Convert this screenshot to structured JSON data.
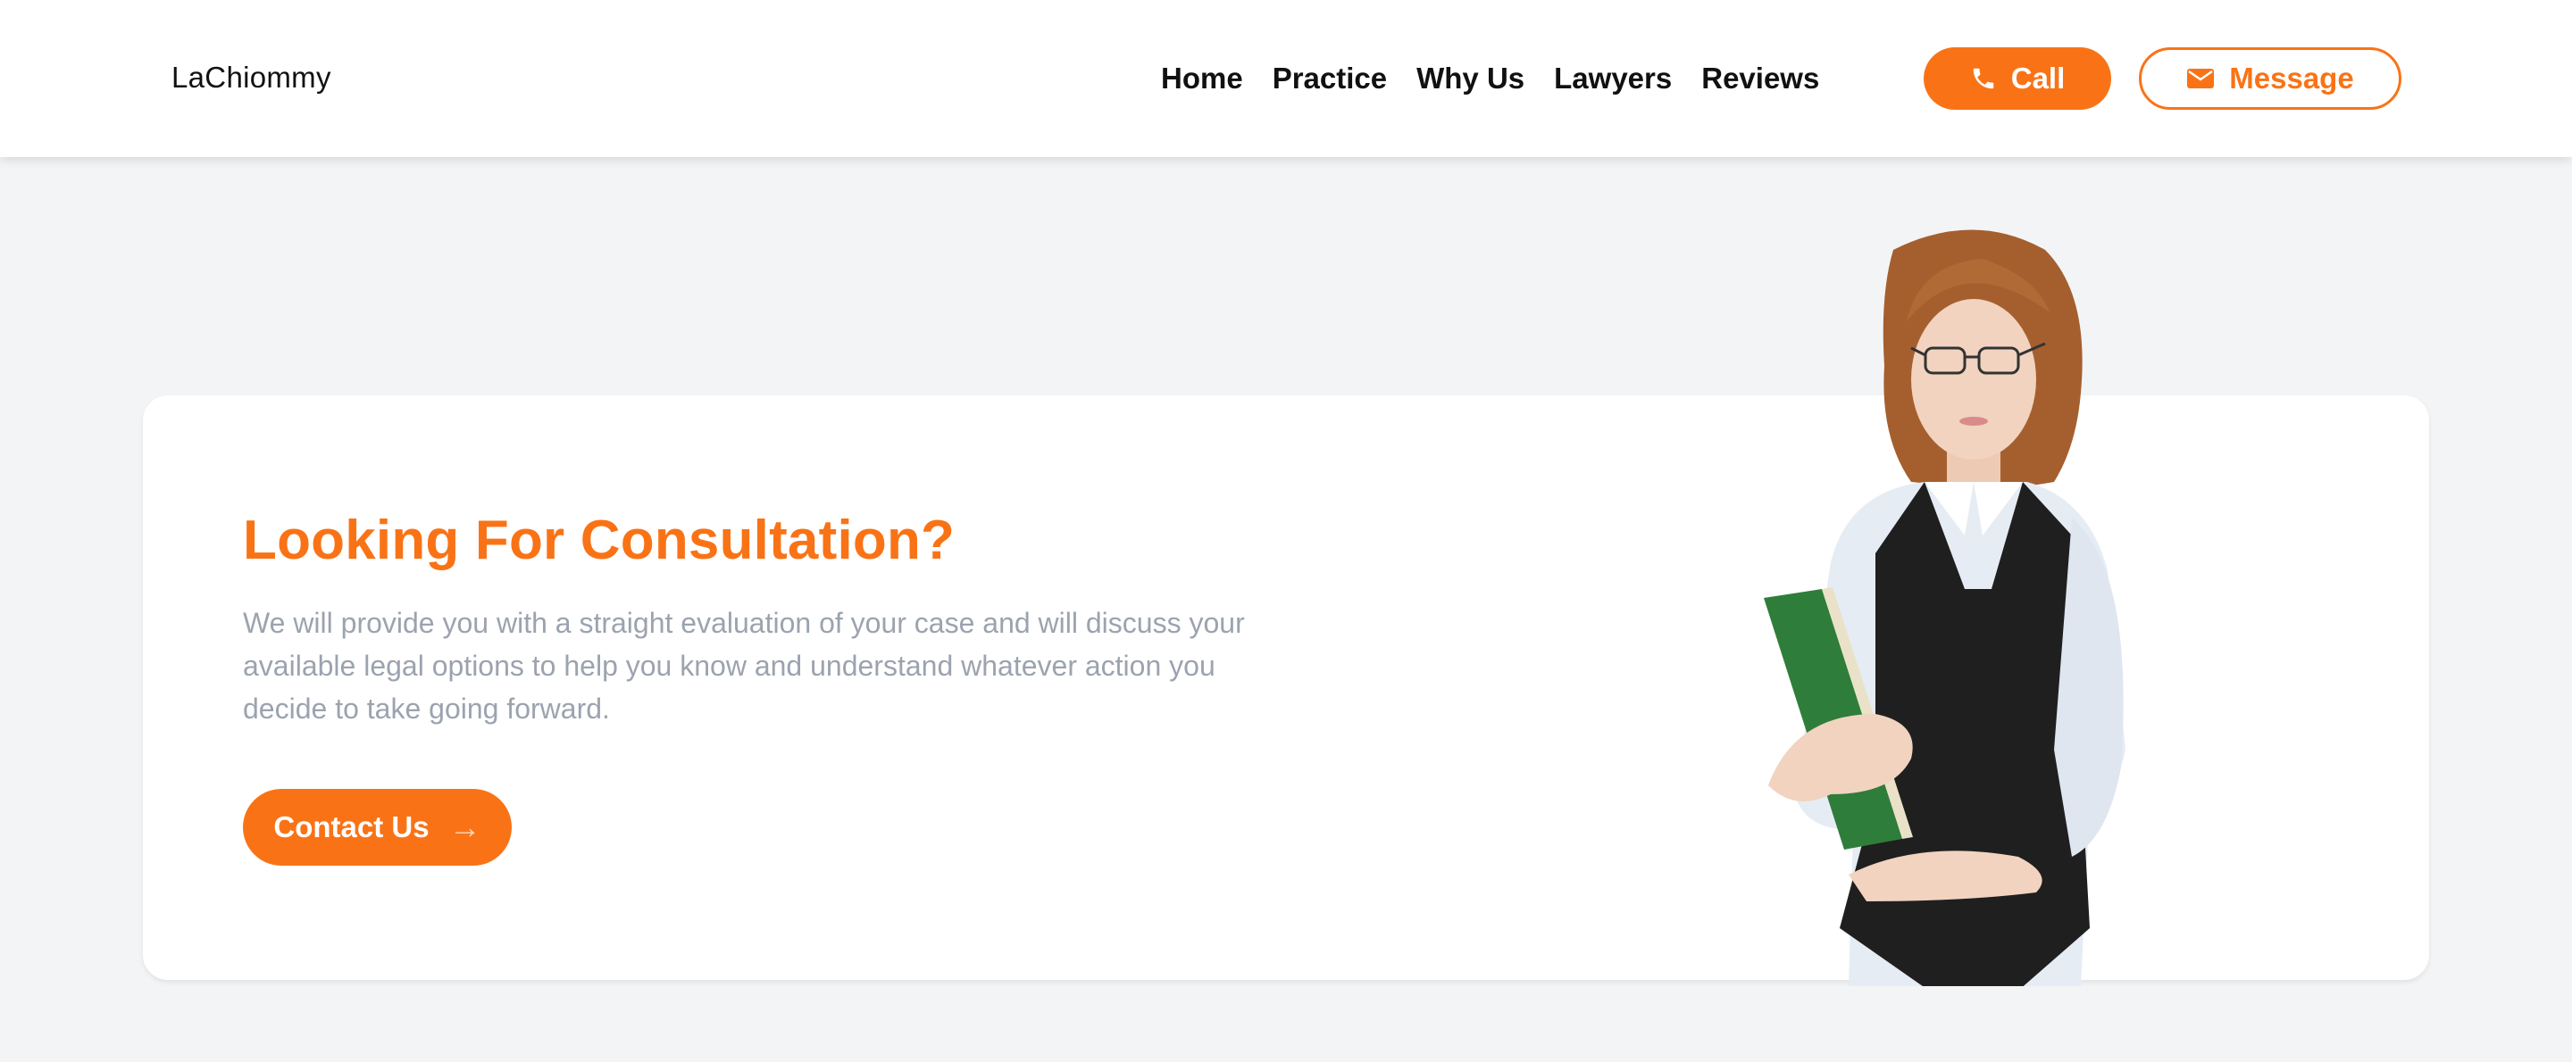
{
  "header": {
    "logo": "LaChiommy",
    "nav": [
      "Home",
      "Practice",
      "Why Us",
      "Lawyers",
      "Reviews"
    ],
    "call_label": "Call",
    "call_icon": "phone-icon",
    "message_label": "Message",
    "message_icon": "envelope-icon"
  },
  "hero": {
    "title": "Looking For Consultation?",
    "description": "We will provide you with a straight evaluation of your case and will discuss your available legal options to help you know and understand whatever action you decide to take going forward.",
    "cta_label": "Contact Us",
    "cta_icon": "arrow-right-icon"
  },
  "colors": {
    "accent": "#f97316",
    "background": "#f3f4f6",
    "muted_text": "#9ca3af"
  }
}
